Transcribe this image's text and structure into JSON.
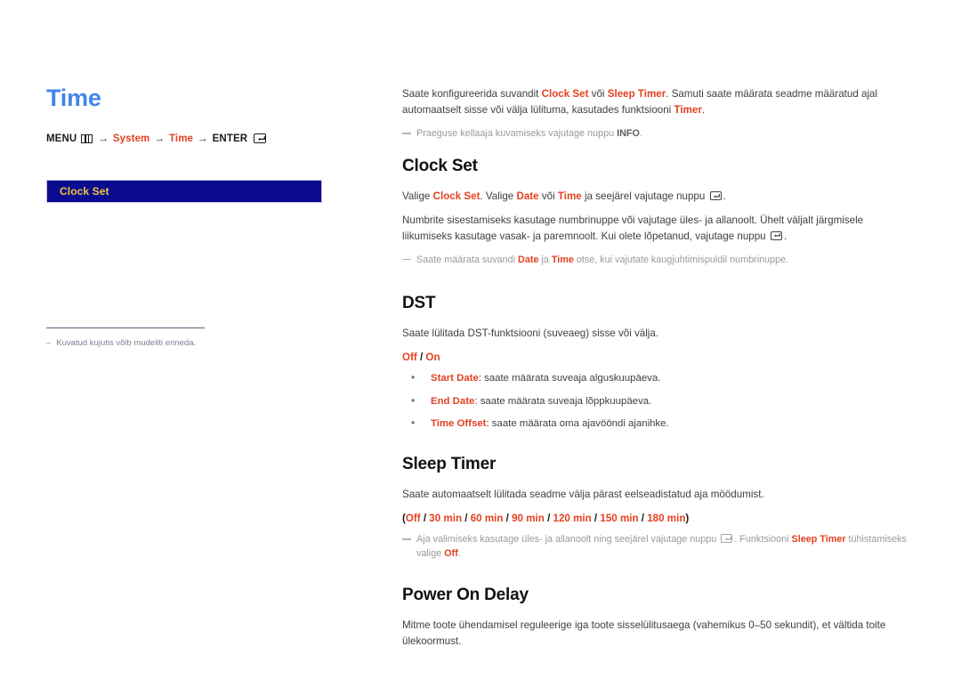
{
  "left": {
    "page_title": "Time",
    "menu_path": {
      "menu_label": "MENU",
      "menu_icon": "menu-grid-icon",
      "arrow": "→",
      "item1": "System",
      "item2": "Time",
      "enter_label": "ENTER",
      "enter_icon": "enter-key-icon"
    },
    "osd_box": {
      "label": "Clock Set",
      "bg_color": "#0b0b8f",
      "text_color": "#f2c53d"
    },
    "footnote": {
      "dash": "‒",
      "text": "Kuvatud kujutis võib mudeliti erineda."
    }
  },
  "right": {
    "intro": {
      "part1": "Saate konfigureerida suvandit ",
      "term1": "Clock Set",
      "part2": " või ",
      "term2": "Sleep Timer",
      "part3": ". Samuti saate määrata seadme määratud ajal automaatselt sisse või välja lülituma, kasutades funktsiooni ",
      "term3": "Timer",
      "part4": "."
    },
    "intro_note": {
      "part1": "Praeguse kellaaja kuvamiseks vajutage nuppu ",
      "term1": "INFO",
      "part2": "."
    },
    "sections": [
      {
        "heading": "Clock Set",
        "p1": {
          "part1": "Valige ",
          "term1": "Clock Set",
          "part2": ". Valige ",
          "term2": "Date",
          "part3": " või ",
          "term3": "Time",
          "part4": " ja seejärel vajutage nuppu ",
          "icon": "enter-key-icon",
          "part5": "."
        },
        "p2": {
          "text": "Numbrite sisestamiseks kasutage numbrinuppe või vajutage üles- ja allanoolt. Ühelt väljalt järgmisele liikumiseks kasutage vasak- ja paremnoolt. Kui olete lõpetanud, vajutage nuppu ",
          "icon": "enter-key-icon",
          "text_end": "."
        },
        "note": {
          "part1": "Saate määrata suvandi ",
          "term1": "Date",
          "part2": " ja ",
          "term2": "Time",
          "part3": " otse, kui vajutate kaugjuhtimispuldil numbrinuppe."
        }
      },
      {
        "heading": "DST",
        "p1": "Saate lülitada DST-funktsiooni (suveaeg) sisse või välja.",
        "options": {
          "opt1": "Off",
          "sep": " / ",
          "opt2": "On"
        },
        "bullets": [
          {
            "term": "Start Date",
            "text": ": saate määrata suveaja alguskuupäeva."
          },
          {
            "term": "End Date",
            "text": ": saate määrata suveaja lõppkuupäeva."
          },
          {
            "term": "Time Offset",
            "text": ": saate määrata oma ajavööndi ajanihke."
          }
        ]
      },
      {
        "heading": "Sleep Timer",
        "p1": "Saate automaatselt lülitada seadme välja pärast eelseadistatud aja möödumist.",
        "options_line": {
          "open": "(",
          "items": [
            "Off",
            "30 min",
            "60 min",
            "90 min",
            "120 min",
            "150 min",
            "180 min"
          ],
          "sep": " / ",
          "close": ")"
        },
        "note": {
          "part1": "Aja valimiseks kasutage üles- ja allanoolt ning seejärel vajutage nuppu ",
          "icon": "enter-key-icon",
          "part2": ". Funktsiooni ",
          "term1": "Sleep Timer",
          "part3": " tühistamiseks valige ",
          "term2": "Off",
          "part4": "."
        }
      },
      {
        "heading": "Power On Delay",
        "p1": "Mitme toote ühendamisel reguleerige iga toote sisselülitusaega (vahemikus 0–50 sekundit), et vältida toite ülekoormust."
      }
    ]
  },
  "colors": {
    "title_blue": "#4285ea",
    "accent_red": "#e4411f",
    "osd_navy": "#0b0b8f",
    "osd_gold": "#f2c53d",
    "note_gray": "#9a9a9a",
    "body_gray": "#3f3f3f"
  }
}
